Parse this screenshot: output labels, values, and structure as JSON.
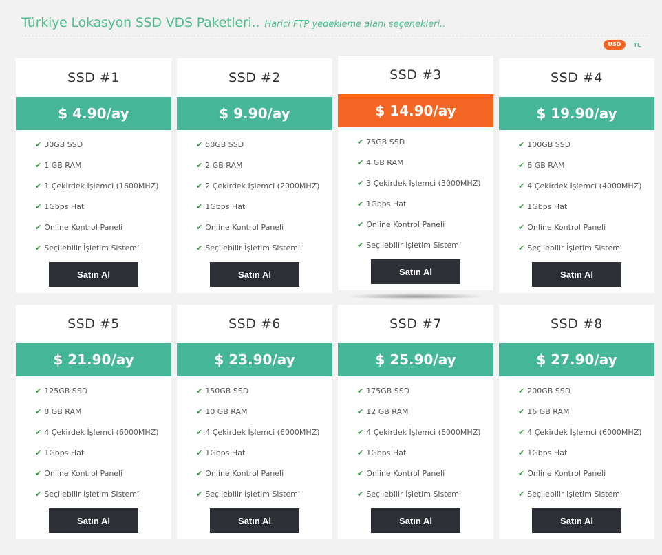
{
  "header": {
    "title": "Türkiye Lokasyon SSD VDS Paketleri..",
    "subtitle": "Harici FTP yedekleme alanı seçenekleri.."
  },
  "currency": {
    "usd": "USD",
    "tl": "TL"
  },
  "colors": {
    "accent": "#45b697",
    "featured": "#f26522",
    "button": "#2d2f36",
    "title": "#4fc08d"
  },
  "packages": [
    {
      "name": "SSD #1",
      "price": "$ 4.90/ay",
      "features": [
        "30GB SSD",
        "1 GB RAM",
        "1 Çekirdek İşlemci (1600MHZ)",
        "1Gbps Hat",
        "Online Kontrol Paneli",
        "Seçilebilir İşletim Sistemi"
      ],
      "button": "Satın Al"
    },
    {
      "name": "SSD #2",
      "price": "$ 9.90/ay",
      "features": [
        "50GB SSD",
        "2 GB RAM",
        "2 Çekirdek İşlemci (2000MHZ)",
        "1Gbps Hat",
        "Online Kontrol Paneli",
        "Seçilebilir İşletim Sistemi"
      ],
      "button": "Satın Al"
    },
    {
      "name": "SSD #3",
      "price": "$ 14.90/ay",
      "features": [
        "75GB SSD",
        "4 GB RAM",
        "3 Çekirdek İşlemci (3000MHZ)",
        "1Gbps Hat",
        "Online Kontrol Paneli",
        "Seçilebilir İşletim Sistemi"
      ],
      "button": "Satın Al"
    },
    {
      "name": "SSD #4",
      "price": "$ 19.90/ay",
      "features": [
        "100GB SSD",
        "6 GB RAM",
        "4 Çekirdek İşlemci (4000MHZ)",
        "1Gbps Hat",
        "Online Kontrol Paneli",
        "Seçilebilir İşletim Sistemi"
      ],
      "button": "Satın Al"
    },
    {
      "name": "SSD #5",
      "price": "$ 21.90/ay",
      "features": [
        "125GB SSD",
        "8 GB RAM",
        "4 Çekirdek İşlemci (6000MHZ)",
        "1Gbps Hat",
        "Online Kontrol Paneli",
        "Seçilebilir İşletim Sistemi"
      ],
      "button": "Satın Al"
    },
    {
      "name": "SSD #6",
      "price": "$ 23.90/ay",
      "features": [
        "150GB SSD",
        "10 GB RAM",
        "4 Çekirdek İşlemci (6000MHZ)",
        "1Gbps Hat",
        "Online Kontrol Paneli",
        "Seçilebilir İşletim Sistemi"
      ],
      "button": "Satın Al"
    },
    {
      "name": "SSD #7",
      "price": "$ 25.90/ay",
      "features": [
        "175GB SSD",
        "12 GB RAM",
        "4 Çekirdek İşlemci (6000MHZ)",
        "1Gbps Hat",
        "Online Kontrol Paneli",
        "Seçilebilir İşletim Sistemi"
      ],
      "button": "Satın Al"
    },
    {
      "name": "SSD #8",
      "price": "$ 27.90/ay",
      "features": [
        "200GB SSD",
        "16 GB RAM",
        "4 Çekirdek İşlemci (6000MHZ)",
        "1Gbps Hat",
        "Online Kontrol Paneli",
        "Seçilebilir İşletim Sistemi"
      ],
      "button": "Satın Al"
    }
  ]
}
